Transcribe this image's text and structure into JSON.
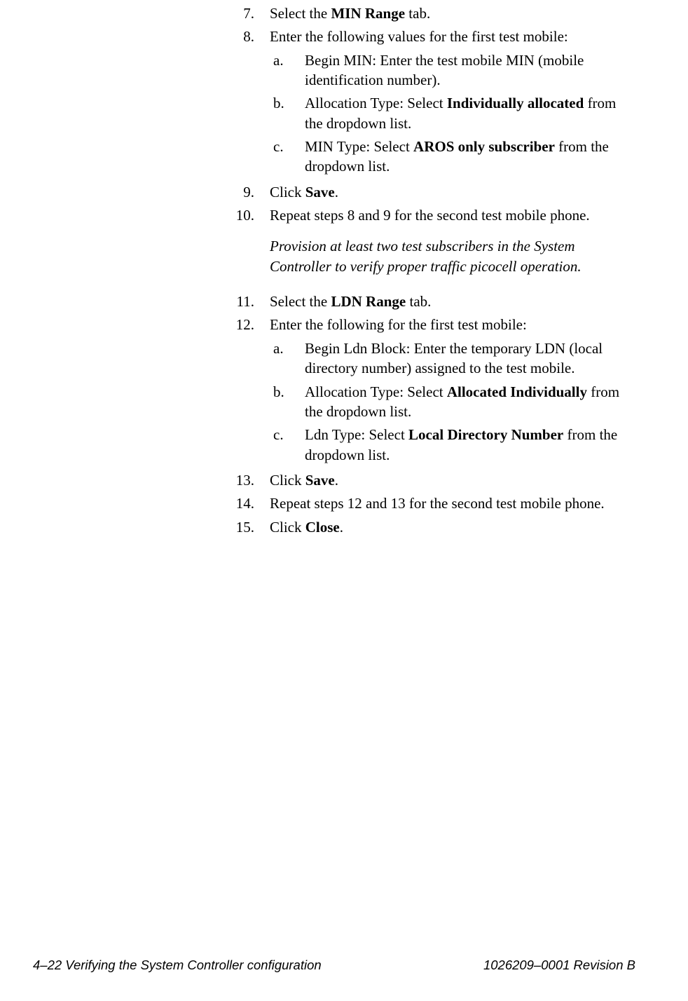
{
  "steps": {
    "s7": {
      "n": "7.",
      "pre": "Select the ",
      "bold": "MIN Range",
      "post": " tab."
    },
    "s8": {
      "n": "8.",
      "intro": "Enter the following values for the first test mobile:",
      "a": {
        "m": "a.",
        "text": "Begin MIN:  Enter the test mobile MIN (mobile identification number)."
      },
      "b": {
        "m": "b.",
        "pre": "Allocation Type:  Select ",
        "bold": "Individually allocated",
        "post": " from the dropdown list."
      },
      "c": {
        "m": "c.",
        "pre": "MIN Type:  Select ",
        "bold": "AROS only subscriber",
        "post": " from the dropdown list."
      }
    },
    "s9": {
      "n": "9.",
      "pre": "Click ",
      "bold": "Save",
      "post": "."
    },
    "s10": {
      "n": "10.",
      "text": "Repeat steps 8 and 9 for the second test mobile phone."
    },
    "note": "Provision at least two test subscribers in the System Controller to verify proper traffic picocell operation.",
    "s11": {
      "n": "11.",
      "pre": "Select the ",
      "bold": "LDN Range",
      "post": " tab."
    },
    "s12": {
      "n": "12.",
      "intro": "Enter the following for the first test mobile:",
      "a": {
        "m": "a.",
        "text": "Begin Ldn Block:  Enter the temporary LDN (local directory number) assigned to the test mobile."
      },
      "b": {
        "m": "b.",
        "pre": "Allocation Type:  Select ",
        "bold": "Allocated Individually",
        "post": " from the dropdown list."
      },
      "c": {
        "m": "c.",
        "pre": "Ldn Type:  Select ",
        "bold": "Local Directory Number",
        "post": " from the dropdown list."
      }
    },
    "s13": {
      "n": "13.",
      "pre": "Click ",
      "bold": "Save",
      "post": "."
    },
    "s14": {
      "n": "14.",
      "text": "Repeat steps 12 and 13 for the second test mobile phone."
    },
    "s15": {
      "n": "15.",
      "pre": "Click ",
      "bold": "Close",
      "post": "."
    }
  },
  "footer": {
    "left": "4–22  Verifying the System Controller configuration",
    "right": "1026209–0001  Revision B"
  }
}
